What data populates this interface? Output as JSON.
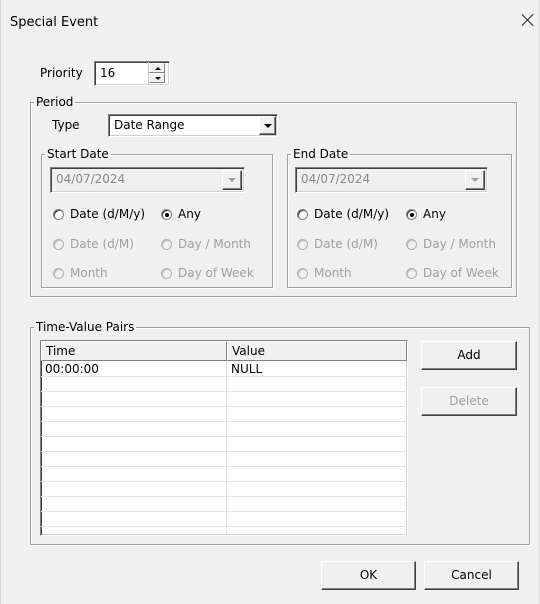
{
  "window": {
    "title": "Special Event",
    "close_icon": "close-icon"
  },
  "priority": {
    "label": "Priority",
    "value": "16"
  },
  "period": {
    "legend": "Period",
    "type_label": "Type",
    "type_value": "Date Range",
    "start": {
      "legend": "Start Date",
      "date_value": "04/07/2024",
      "options": [
        {
          "label": "Date (d/M/y)",
          "checked": false,
          "enabled": true
        },
        {
          "label": "Any",
          "checked": true,
          "enabled": true
        },
        {
          "label": "Date (d/M)",
          "checked": false,
          "enabled": false
        },
        {
          "label": "Day / Month",
          "checked": false,
          "enabled": false
        },
        {
          "label": "Month",
          "checked": false,
          "enabled": false
        },
        {
          "label": "Day of Week",
          "checked": false,
          "enabled": false
        }
      ]
    },
    "end": {
      "legend": "End Date",
      "date_value": "04/07/2024",
      "options": [
        {
          "label": "Date (d/M/y)",
          "checked": false,
          "enabled": true
        },
        {
          "label": "Any",
          "checked": true,
          "enabled": true
        },
        {
          "label": "Date (d/M)",
          "checked": false,
          "enabled": false
        },
        {
          "label": "Day / Month",
          "checked": false,
          "enabled": false
        },
        {
          "label": "Month",
          "checked": false,
          "enabled": false
        },
        {
          "label": "Day of Week",
          "checked": false,
          "enabled": false
        }
      ]
    }
  },
  "pairs": {
    "legend": "Time-Value Pairs",
    "columns": [
      "Time",
      "Value"
    ],
    "rows": [
      [
        "00:00:00",
        "NULL"
      ]
    ],
    "add_label": "Add",
    "delete_label": "Delete"
  },
  "footer": {
    "ok_label": "OK",
    "cancel_label": "Cancel"
  }
}
